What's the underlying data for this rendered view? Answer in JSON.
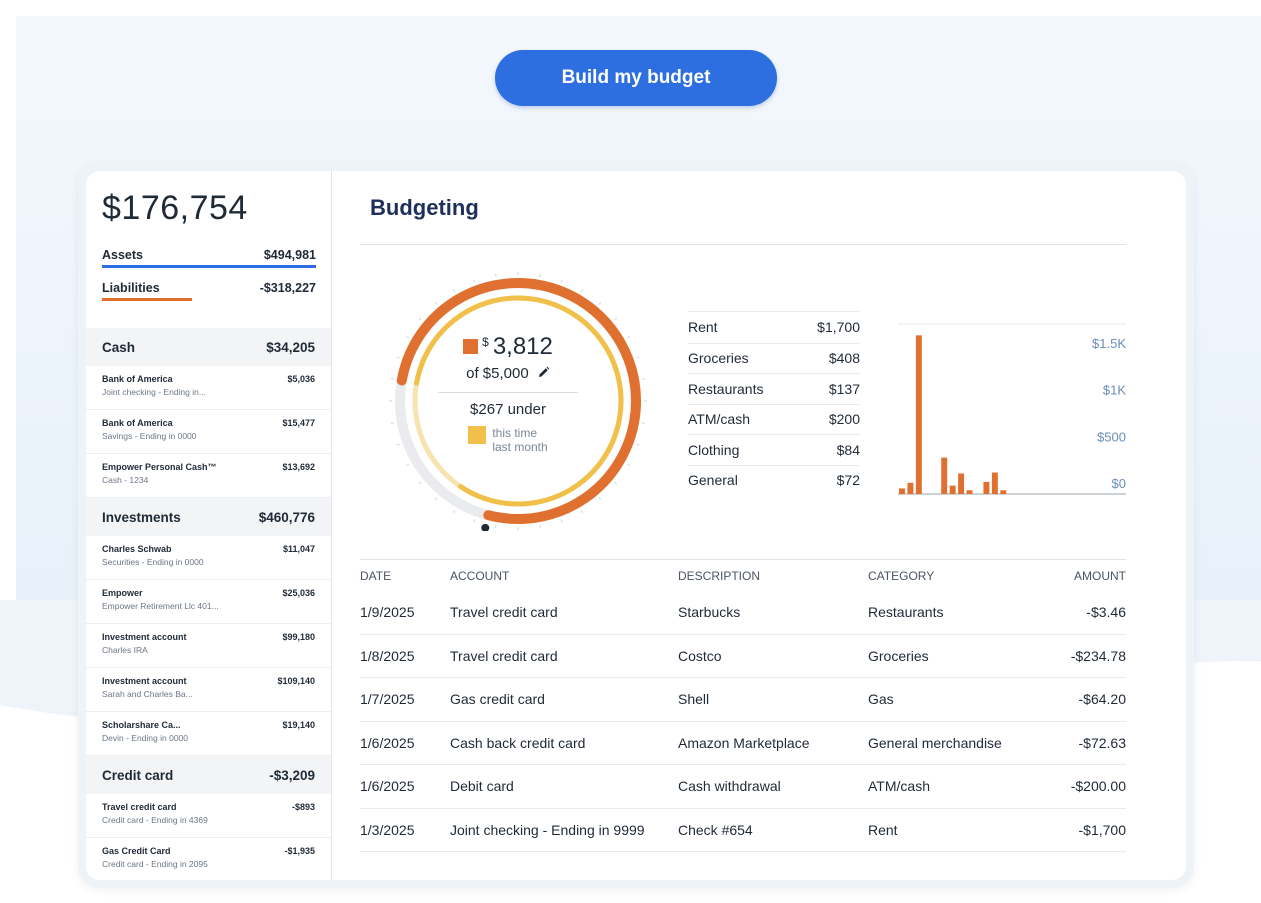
{
  "cta_label": "Build my budget",
  "sidebar": {
    "net_worth": "$176,754",
    "assets": {
      "label": "Assets",
      "value": "$494,981"
    },
    "liabilities": {
      "label": "Liabilities",
      "value": "-$318,227"
    },
    "groups": [
      {
        "name": "Cash",
        "total": "$34,205",
        "accounts": [
          {
            "name": "Bank of America",
            "detail": "Joint checking - Ending in...",
            "value": "$5,036"
          },
          {
            "name": "Bank of America",
            "detail": "Savings - Ending in 0000",
            "value": "$15,477"
          },
          {
            "name": "Empower Personal Cash™",
            "detail": "Cash - 1234",
            "value": "$13,692"
          }
        ]
      },
      {
        "name": "Investments",
        "total": "$460,776",
        "accounts": [
          {
            "name": "Charles Schwab",
            "detail": "Securities - Ending in 0000",
            "value": "$11,047"
          },
          {
            "name": "Empower",
            "detail": "Empower Retirement Llc 401...",
            "value": "$25,036"
          },
          {
            "name": "Investment account",
            "detail": "Charles IRA",
            "value": "$99,180"
          },
          {
            "name": "Investment account",
            "detail": "Sarah and Charles Ba...",
            "value": "$109,140"
          },
          {
            "name": "Scholarshare Ca...",
            "detail": "Devin - Ending in 0000",
            "value": "$19,140"
          }
        ]
      },
      {
        "name": "Credit card",
        "total": "-$3,209",
        "accounts": [
          {
            "name": "Travel credit card",
            "detail": "Credit card - Ending in 4369",
            "value": "-$893"
          },
          {
            "name": "Gas Credit Card",
            "detail": "Credit card - Ending in 2095",
            "value": "-$1,935"
          }
        ]
      }
    ]
  },
  "budget": {
    "title": "Budgeting",
    "currency_symbol": "$",
    "spent": "3,812",
    "of_label": "of $5,000",
    "under_label": "$267 under",
    "legend_label_1": "this time",
    "legend_label_2": "last month",
    "spent_fraction": 0.7624,
    "last_month_fraction": 0.816,
    "colors": {
      "spent": "#e0702f",
      "last_month": "#f0c04a",
      "track": "#e9ebee"
    },
    "categories": [
      {
        "name": "Rent",
        "value": "$1,700"
      },
      {
        "name": "Groceries",
        "value": "$408"
      },
      {
        "name": "Restaurants",
        "value": "$137"
      },
      {
        "name": "ATM/cash",
        "value": "$200"
      },
      {
        "name": "Clothing",
        "value": "$84"
      },
      {
        "name": "General",
        "value": "$72"
      }
    ]
  },
  "chart_data": {
    "type": "bar",
    "y_ticks": [
      "$1.5K",
      "$1K",
      "$500",
      "$0"
    ],
    "y_tick_values": [
      1500,
      1000,
      500,
      0
    ],
    "ylim": [
      0,
      1800
    ],
    "values": [
      60,
      120,
      1700,
      0,
      0,
      390,
      90,
      220,
      40,
      0,
      130,
      230,
      40,
      0,
      0,
      0,
      0,
      0,
      0,
      0,
      0,
      0,
      0,
      0,
      0,
      0,
      0
    ],
    "color": "#e0702f"
  },
  "transactions": {
    "headers": [
      "DATE",
      "ACCOUNT",
      "DESCRIPTION",
      "CATEGORY",
      "AMOUNT"
    ],
    "rows": [
      [
        "1/9/2025",
        "Travel credit card",
        "Starbucks",
        "Restaurants",
        "-$3.46"
      ],
      [
        "1/8/2025",
        "Travel credit card",
        "Costco",
        "Groceries",
        "-$234.78"
      ],
      [
        "1/7/2025",
        "Gas credit card",
        "Shell",
        "Gas",
        "-$64.20"
      ],
      [
        "1/6/2025",
        "Cash back credit card",
        "Amazon Marketplace",
        "General merchandise",
        "-$72.63"
      ],
      [
        "1/6/2025",
        "Debit card",
        "Cash withdrawal",
        "ATM/cash",
        "-$200.00"
      ],
      [
        "1/3/2025",
        "Joint checking - Ending in 9999",
        "Check #654",
        "Rent",
        "-$1,700"
      ]
    ]
  }
}
